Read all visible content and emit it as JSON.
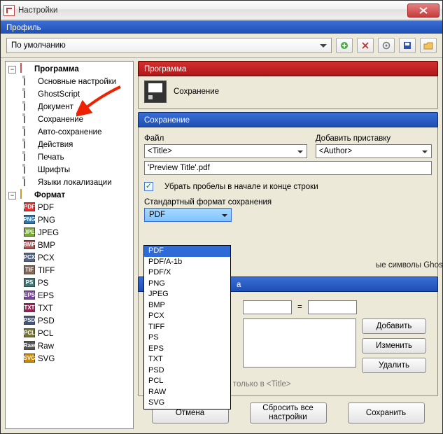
{
  "window": {
    "title": "Настройки"
  },
  "profile": {
    "header": "Профиль",
    "selected": "По умолчанию"
  },
  "sidebar": {
    "group_program": "Программа",
    "program_items": [
      "Основные настройки",
      "GhostScript",
      "Документ",
      "Сохранение",
      "Авто-сохранение",
      "Действия",
      "Печать",
      "Шрифты",
      "Языки локализации"
    ],
    "group_format": "Формат",
    "format_items": [
      "PDF",
      "PNG",
      "JPEG",
      "BMP",
      "PCX",
      "TIFF",
      "PS",
      "EPS",
      "TXT",
      "PSD",
      "PCL",
      "Raw",
      "SVG"
    ],
    "format_colors": [
      "#d33",
      "#37a",
      "#7a3",
      "#a55",
      "#568",
      "#865",
      "#477",
      "#749",
      "#925",
      "#457",
      "#773",
      "#555",
      "#c80"
    ]
  },
  "main": {
    "prog_header": "Программа",
    "prog_sub": "Сохранение",
    "save_header": "Сохранение",
    "file_label": "Файл",
    "file_value": "<Title>",
    "prefix_label": "Добавить приставку",
    "prefix_value": "<Author>",
    "preview_value": "'Preview Title'.pdf",
    "trim_label": "Убрать пробелы в начале и конце строки",
    "stdfmt_label": "Стандартный формат сохранения",
    "stdfmt_value": "PDF",
    "ghost_note": "ые символы  Ghostscript в имени файла",
    "subst_caption_partial": "а",
    "eq": "=",
    "btn_add": "Добавить",
    "btn_edit": "Изменить",
    "btn_del": "Удалить",
    "footer_note": "Замена имени файла только в <Title>"
  },
  "dropdown_options": [
    "PDF",
    "PDF/A-1b",
    "PDF/X",
    "PNG",
    "JPEG",
    "BMP",
    "PCX",
    "TIFF",
    "PS",
    "EPS",
    "TXT",
    "PSD",
    "PCL",
    "RAW",
    "SVG"
  ],
  "footer": {
    "cancel": "Отмена",
    "reset": "Сбросить все настройки",
    "save": "Сохранить"
  }
}
